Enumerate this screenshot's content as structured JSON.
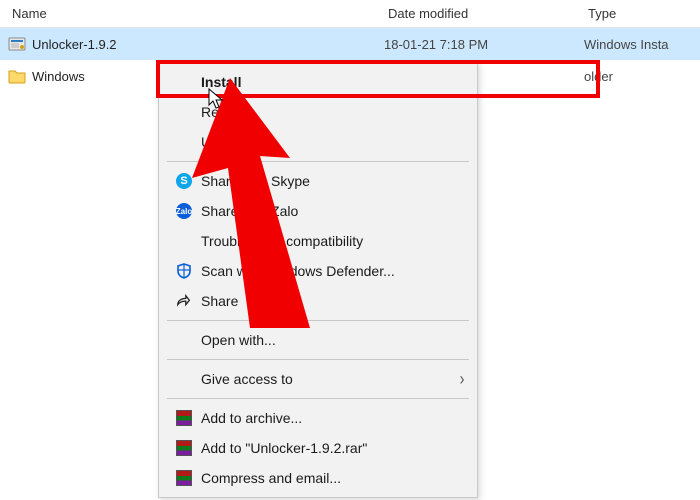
{
  "columns": {
    "name": "Name",
    "date": "Date modified",
    "type": "Type"
  },
  "files": [
    {
      "name": "Unlocker-1.9.2",
      "date": "18-01-21 7:18 PM",
      "type": "Windows Insta"
    },
    {
      "name": "Windows",
      "date": "",
      "type": "older"
    }
  ],
  "menu": {
    "install": "Install",
    "repair": "Repair",
    "uninstall": "Uninstall",
    "share_skype": "Share with Skype",
    "share_zalo": "Share with Zalo",
    "troubleshoot": "Troubleshoot compatibility",
    "defender": "Scan with Windows Defender...",
    "share": "Share",
    "open_with": "Open with...",
    "give_access": "Give access to",
    "add_archive": "Add to archive...",
    "add_rar": "Add to \"Unlocker-1.9.2.rar\"",
    "compress_email": "Compress and email..."
  },
  "icons": {
    "zalo_text": "Zalo",
    "skype_text": "S"
  }
}
